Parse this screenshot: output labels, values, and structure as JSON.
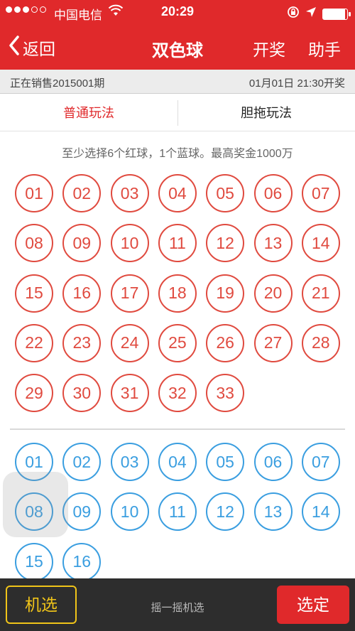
{
  "status": {
    "carrier": "中国电信",
    "time": "20:29"
  },
  "nav": {
    "back_label": "返回",
    "title": "双色球",
    "draw_label": "开奖",
    "helper_label": "助手"
  },
  "issue": {
    "left": "正在销售2015001期",
    "right": "01月01日 21:30开奖"
  },
  "tabs": {
    "normal": "普通玩法",
    "dantuo": "胆拖玩法"
  },
  "hint": "至少选择6个红球，1个蓝球。最高奖金1000万",
  "red_balls": [
    "01",
    "02",
    "03",
    "04",
    "05",
    "06",
    "07",
    "08",
    "09",
    "10",
    "11",
    "12",
    "13",
    "14",
    "15",
    "16",
    "17",
    "18",
    "19",
    "20",
    "21",
    "22",
    "23",
    "24",
    "25",
    "26",
    "27",
    "28",
    "29",
    "30",
    "31",
    "32",
    "33"
  ],
  "blue_balls": [
    "01",
    "02",
    "03",
    "04",
    "05",
    "06",
    "07",
    "08",
    "09",
    "10",
    "11",
    "12",
    "13",
    "14",
    "15",
    "16"
  ],
  "bottom": {
    "random_label": "机选",
    "shake_label": "摇一摇机选",
    "confirm_label": "选定"
  },
  "colors": {
    "accent": "#e0292b",
    "red_ball": "#e04a3f",
    "blue_ball": "#3a9ee0",
    "random": "#f0c419"
  },
  "icons": {
    "back": "chevron-left-icon",
    "wifi": "wifi-icon",
    "lock": "rotation-lock-icon",
    "location": "location-arrow-icon",
    "battery": "battery-icon"
  }
}
